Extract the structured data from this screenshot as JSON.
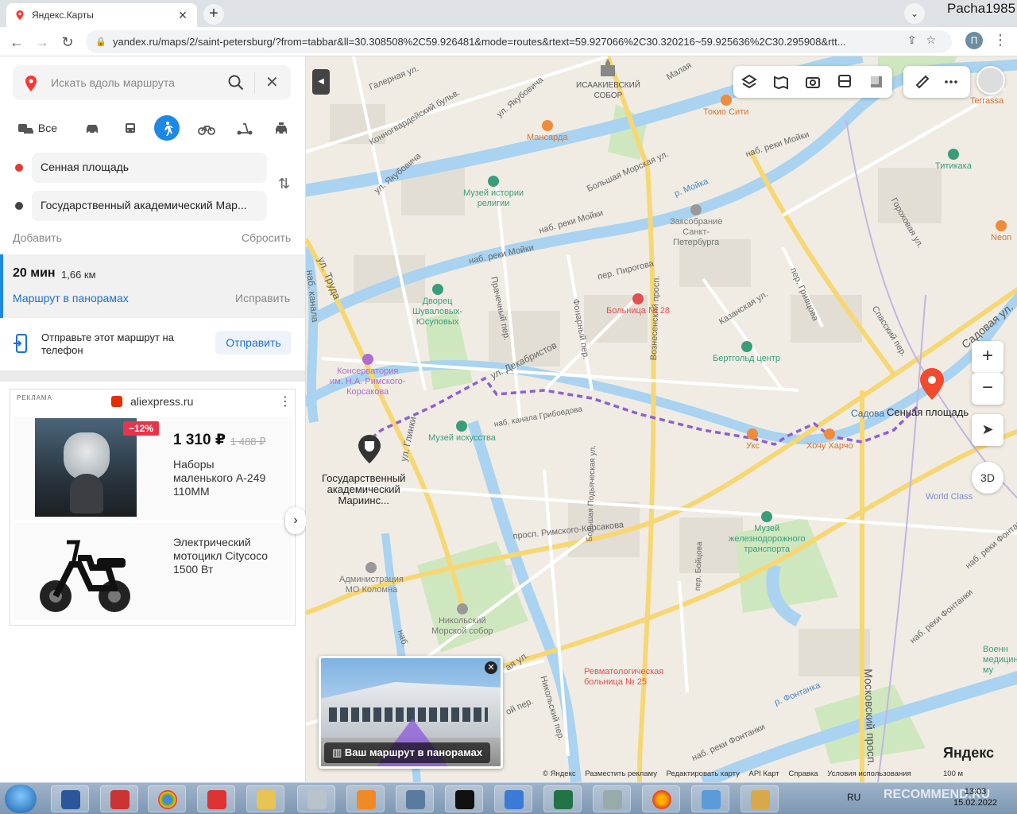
{
  "browser": {
    "tab_title": "Яндекс.Карты",
    "url": "yandex.ru/maps/2/saint-petersburg/?from=tabbar&ll=30.308508%2C59.926481&mode=routes&rtext=59.927066%2C30.320216~59.925636%2C30.295908&rtt...",
    "profile_letter": "П",
    "overlay_user": "Pacha1985"
  },
  "panel": {
    "search_placeholder": "Искать вдоль маршрута",
    "modes": [
      {
        "name": "all",
        "label": "Все"
      },
      {
        "name": "car"
      },
      {
        "name": "transit"
      },
      {
        "name": "walk"
      },
      {
        "name": "bike"
      },
      {
        "name": "scooter"
      },
      {
        "name": "taxi"
      }
    ],
    "from": "Сенная площадь",
    "to": "Государственный академический Мар...",
    "add_label": "Добавить",
    "reset_label": "Сбросить",
    "route": {
      "time": "20 мин",
      "distance": "1,66 км",
      "panorama_link": "Маршрут в панорамах",
      "fix_link": "Исправить"
    },
    "send": {
      "text": "Отправьте этот маршрут на телефон",
      "button": "Отправить"
    },
    "ad": {
      "label": "РЕКЛАМА",
      "brand": "aliexpress.ru",
      "item1": {
        "discount": "−12%",
        "price": "1 310 ₽",
        "old_price": "1 488 ₽",
        "title": "Наборы маленького А-249 110ММ"
      },
      "item2": {
        "title": "Электрический мотоцикл Citycoco 1500 Вт"
      }
    }
  },
  "map": {
    "toolbar_icons": [
      "layers-icon",
      "panorama-icon",
      "camera-icon",
      "bus-icon",
      "square-icon"
    ],
    "toolbar2_icons": [
      "ruler-icon",
      "more-icon"
    ],
    "zoom_in": "+",
    "zoom_out": "−",
    "btn_3d": "3D",
    "pano_caption": "Ваш маршрут в панорамах",
    "logo": "Яндекс",
    "scale": "100 м",
    "footer": [
      "© Яндекс",
      "Разместить рекламу",
      "Редактировать карту",
      "API Карт",
      "Справка",
      "Условия использования"
    ],
    "endpoint_label": "Сенная площадь",
    "metro_label": "Садова",
    "start_label": [
      "Государственный",
      "академический",
      "Мариинс..."
    ],
    "labels": [
      {
        "text": "Исаакиевский собор",
        "lines": [
          "ИСААКИЕВСКИЙ",
          "СОБОР"
        ]
      },
      {
        "text": "Токио Сити"
      },
      {
        "text": "Мансарда"
      },
      {
        "text": "Музей истории религии",
        "lines": [
          "Музей истории",
          "религии"
        ]
      },
      {
        "text": "Законодательное собрание",
        "lines": [
          "Заксобрание",
          "Санкт-",
          "Петербурга"
        ]
      },
      {
        "text": "Титикака"
      },
      {
        "text": "Neon"
      },
      {
        "text": "Terrassa"
      },
      {
        "text": "Дворец Шуваловых",
        "lines": [
          "Дворец",
          "Шуваловых-",
          "Юсуповых"
        ]
      },
      {
        "text": "Больница № 28"
      },
      {
        "text": "Бертгольд центр"
      },
      {
        "text": "Консерватория",
        "lines": [
          "Консерватория",
          "им. Н.А. Римского-",
          "Корсакова"
        ]
      },
      {
        "text": "Музей искусства"
      },
      {
        "text": "Хочу Харчо"
      },
      {
        "text": "Укс"
      },
      {
        "text": "Музей железнодорожного транспорта",
        "lines": [
          "Музей",
          "железнодорожного",
          "транспорта"
        ]
      },
      {
        "text": "World Class"
      },
      {
        "text": "Администрация МО Коломна",
        "lines": [
          "Администрация",
          "МО Коломна"
        ]
      },
      {
        "text": "Никольский Морской собор",
        "lines": [
          "Никольский",
          "Морской собор"
        ]
      },
      {
        "text": "Ревматологическая больница № 25",
        "lines": [
          "Ревматологическая",
          "больница № 25"
        ]
      },
      {
        "text": "Военно-медицинский",
        "lines": [
          "Военн",
          "медицинск",
          "му"
        ]
      }
    ],
    "streets": [
      "Галерная ул.",
      "Конногвардейский бульв.",
      "ул. Якубовича",
      "ул. Якубовича",
      "Малая",
      "Большая Морская ул.",
      "р. Мойка",
      "наб. реки Мойки",
      "наб. реки Мойки",
      "наб. реки Мойки",
      "Гороховая ул.",
      "Садовая ул.",
      "ул. Труда",
      "наб. канала",
      "Прачечный пер.",
      "Фонарный пер.",
      "пер. Пирогова",
      "Казанская ул.",
      "пер. Гривцова",
      "Спасский пер.",
      "ул. Декабристов",
      "наб. канала Грибоедова",
      "Вознесенский просп.",
      "ул. Глинки",
      "просп. Римского-Корсакова",
      "Большая Подьяческая ул.",
      "пер. Бойцова",
      "Никольский пер.",
      "наб. реки Фонтанки",
      "р. Фонтанка",
      "Московский просп.",
      "наб. реки Фонтанки",
      "наб. реки Фонтанки",
      "ая ул.",
      "ой пер.",
      "наб."
    ]
  },
  "taskbar": {
    "lang": "RU",
    "time": "13:03",
    "date": "15.02.2022",
    "watermark": "RECOMMEND.RU"
  }
}
